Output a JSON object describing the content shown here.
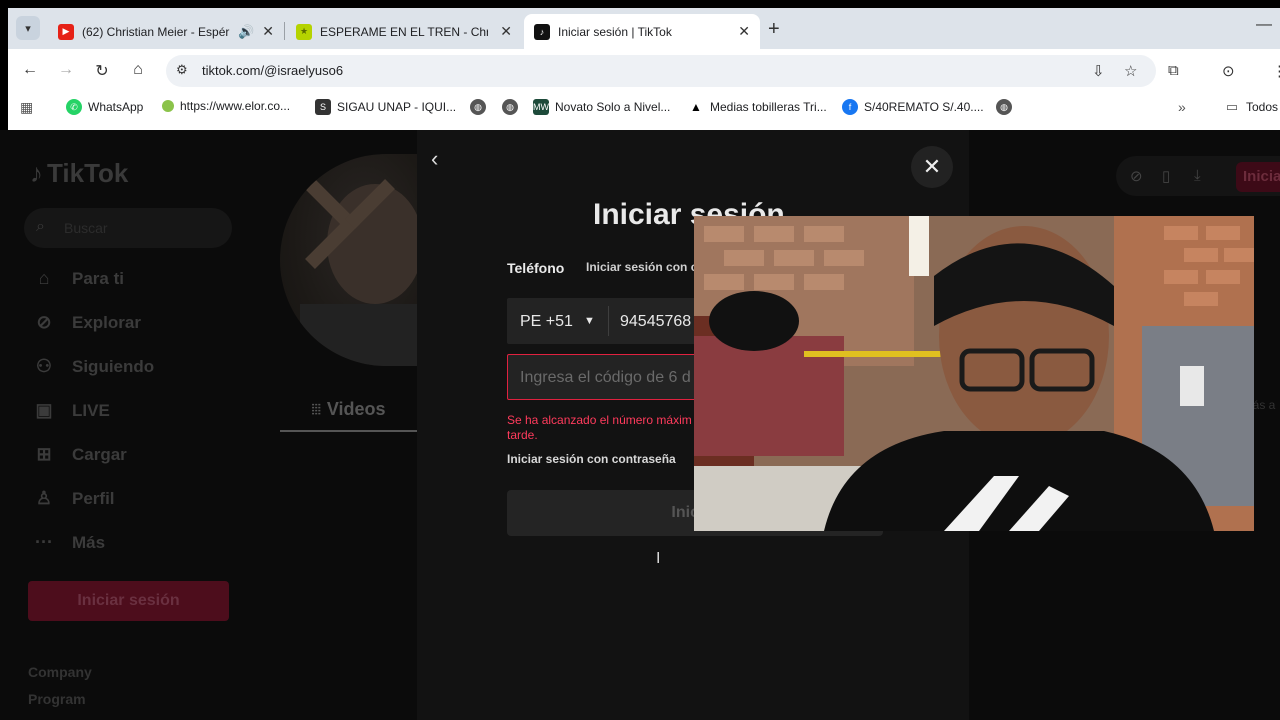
{
  "browser": {
    "tabs": [
      {
        "title": "(62) Christian Meier - Espér",
        "favicon": "youtube-icon",
        "color": "#e62117",
        "audio": true,
        "active": false
      },
      {
        "title": "ESPERAME EN EL TREN - Christ",
        "favicon": "star-icon",
        "color": "#b5d300",
        "active": false
      },
      {
        "title": "Iniciar sesión | TikTok",
        "favicon": "tiktok-icon",
        "color": "#111111",
        "active": true
      }
    ],
    "url": "tiktok.com/@israelyuso6",
    "bookmarks": [
      {
        "label": "WhatsApp",
        "icon": "whatsapp-icon"
      },
      {
        "label": "https://www.elor.co...",
        "icon": "green-dot-icon"
      },
      {
        "label": "SIGAU UNAP - IQUI...",
        "icon": "sigau-icon"
      },
      {
        "label": "",
        "icon": "globe-icon"
      },
      {
        "label": "",
        "icon": "globe-icon"
      },
      {
        "label": "Novato Solo a Nivel...",
        "icon": "mw-icon"
      },
      {
        "label": "Medias tobilleras Tri...",
        "icon": "adidas-icon"
      },
      {
        "label": "S/40REMATO S/.40....",
        "icon": "facebook-icon"
      },
      {
        "label": "",
        "icon": "globe-icon"
      },
      {
        "label": "Todos",
        "icon": "folder-icon"
      }
    ]
  },
  "tiktok": {
    "logo": "TikTok",
    "search_placeholder": "Buscar",
    "nav": [
      {
        "label": "Para ti",
        "icon": "home-icon"
      },
      {
        "label": "Explorar",
        "icon": "compass-icon"
      },
      {
        "label": "Siguiendo",
        "icon": "following-icon"
      },
      {
        "label": "LIVE",
        "icon": "live-icon"
      },
      {
        "label": "Cargar",
        "icon": "upload-icon"
      },
      {
        "label": "Perfil",
        "icon": "profile-icon"
      },
      {
        "label": "Más",
        "icon": "more-icon"
      }
    ],
    "login_button": "Iniciar sesión",
    "footer": [
      "Company",
      "Program"
    ],
    "videos_tab": "Videos",
    "top_login": "Inicia",
    "right_hint": "lás a"
  },
  "modal": {
    "title": "Iniciar sesión",
    "phone_label": "Teléfono",
    "alt_label": "Iniciar sesión con c",
    "country_code": "PE +51",
    "phone_value": "94545768",
    "code_placeholder": "Ingresa el código de 6 d",
    "error": "Se ha alcanzado el número máximo de intentos. Inténtalo más tarde.",
    "error_visible": "Se ha alcanzado el número máxim",
    "error_line2": "tarde.",
    "password_link": "Iniciar sesión con contraseña",
    "submit": "Iniciar"
  },
  "colors": {
    "accent": "#fe2c55",
    "error": "#ff3b5c",
    "modal_bg": "#121212"
  }
}
